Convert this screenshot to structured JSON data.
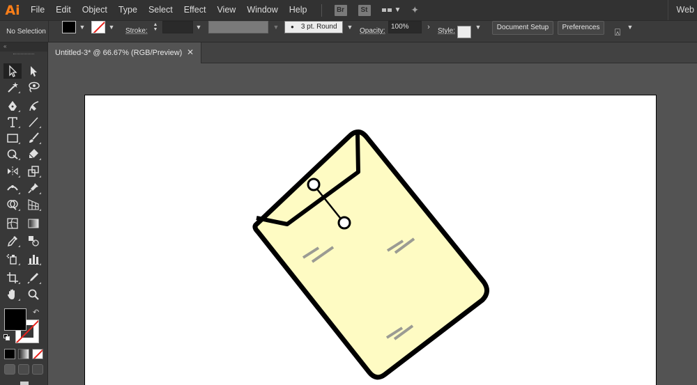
{
  "app": {
    "logo": "Ai"
  },
  "menu": [
    "File",
    "Edit",
    "Object",
    "Type",
    "Select",
    "Effect",
    "View",
    "Window",
    "Help"
  ],
  "menubar_icons": {
    "bridge": "Br",
    "stock": "St"
  },
  "workspace": {
    "label": "Web"
  },
  "control": {
    "selection_state": "No Selection",
    "stroke_label": "Stroke:",
    "brush_value": "3 pt. Round",
    "opacity_label": "Opacity:",
    "opacity_value": "100%",
    "style_label": "Style:",
    "document_setup": "Document Setup",
    "preferences": "Preferences"
  },
  "document": {
    "tab_title": "Untitled-3* @ 66.67% (RGB/Preview)"
  },
  "colors": {
    "app_bg": "#535353",
    "menubar_bg": "#323232",
    "panel_bg": "#383838",
    "logo": "#ff7f18",
    "envelope_fill": "#fefbc3",
    "envelope_stroke": "#000000",
    "marks": "#9b9b93",
    "none_slash": "#e8211a"
  }
}
